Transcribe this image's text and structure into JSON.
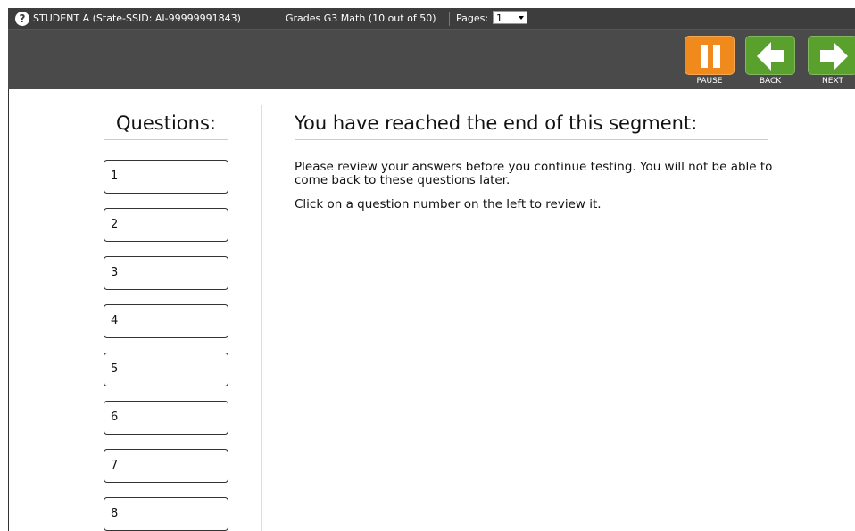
{
  "header": {
    "student": "STUDENT A (State-SSID: AI-99999991843)",
    "test": "Grades G3 Math (10 out of 50)",
    "pages_label": "Pages:",
    "pages_value": "1"
  },
  "toolbar": {
    "pause_label": "PAUSE",
    "back_label": "BACK",
    "next_label": "NEXT"
  },
  "sidebar": {
    "title": "Questions:",
    "questions": [
      "1",
      "2",
      "3",
      "4",
      "5",
      "6",
      "7",
      "8"
    ]
  },
  "main": {
    "heading": "You have reached the end of this segment:",
    "line1": "Please review your answers before you continue testing. You will not be able to come back to these questions later.",
    "line2": "Click on a question number on the left to review it."
  },
  "colors": {
    "topbar": "#3d3d3d",
    "toolbar": "#4a4a4a",
    "pause": "#f08a1c",
    "nav": "#5aa02c"
  }
}
